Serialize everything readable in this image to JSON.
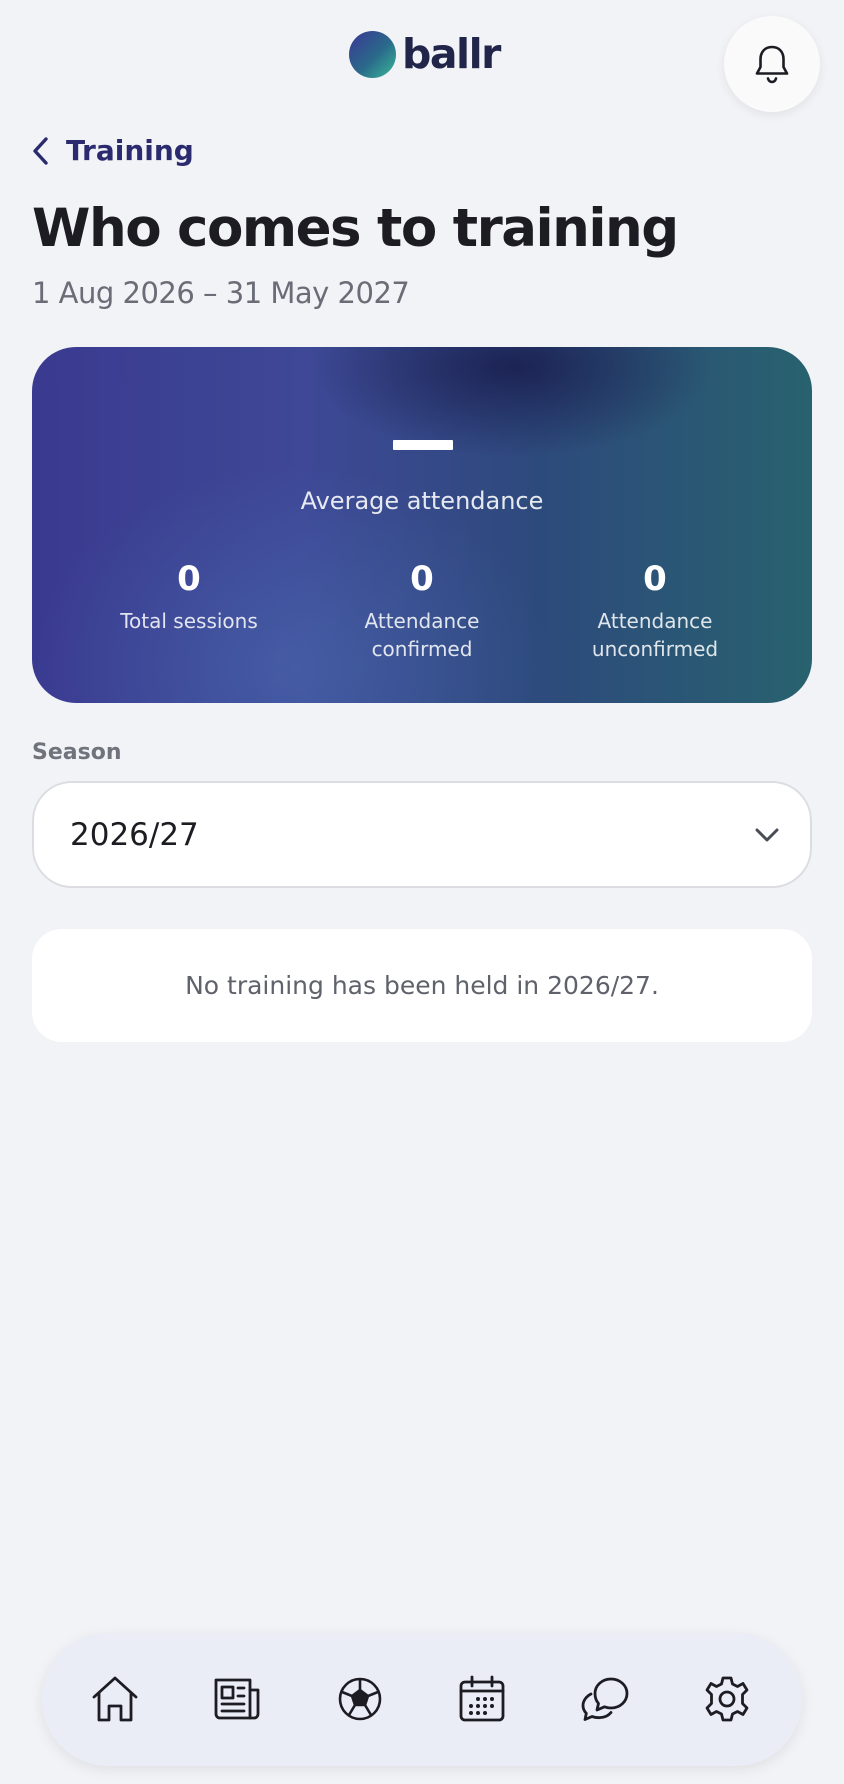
{
  "app": {
    "logo_text": "ballr"
  },
  "header": {
    "back_label": "Training",
    "title": "Who comes to training",
    "date_range": "1 Aug 2026 – 31 May 2027"
  },
  "stats": {
    "average_value": "",
    "average_label": "Average attendance",
    "total_sessions": {
      "value": "0",
      "label": "Total sessions"
    },
    "confirmed": {
      "value": "0",
      "label": "Attendance confirmed"
    },
    "unconfirmed": {
      "value": "0",
      "label": "Attendance unconfirmed"
    }
  },
  "season": {
    "label": "Season",
    "selected": "2026/27"
  },
  "empty_state": {
    "message": "No training has been held in 2026/27."
  },
  "nav": {
    "items": [
      "home-icon",
      "news-icon",
      "football-icon",
      "calendar-icon",
      "chat-icon",
      "settings-icon"
    ]
  },
  "colors": {
    "accent": "#2b2a6e",
    "card_gradient_start": "#3a3a90",
    "card_gradient_end": "#28626e"
  }
}
